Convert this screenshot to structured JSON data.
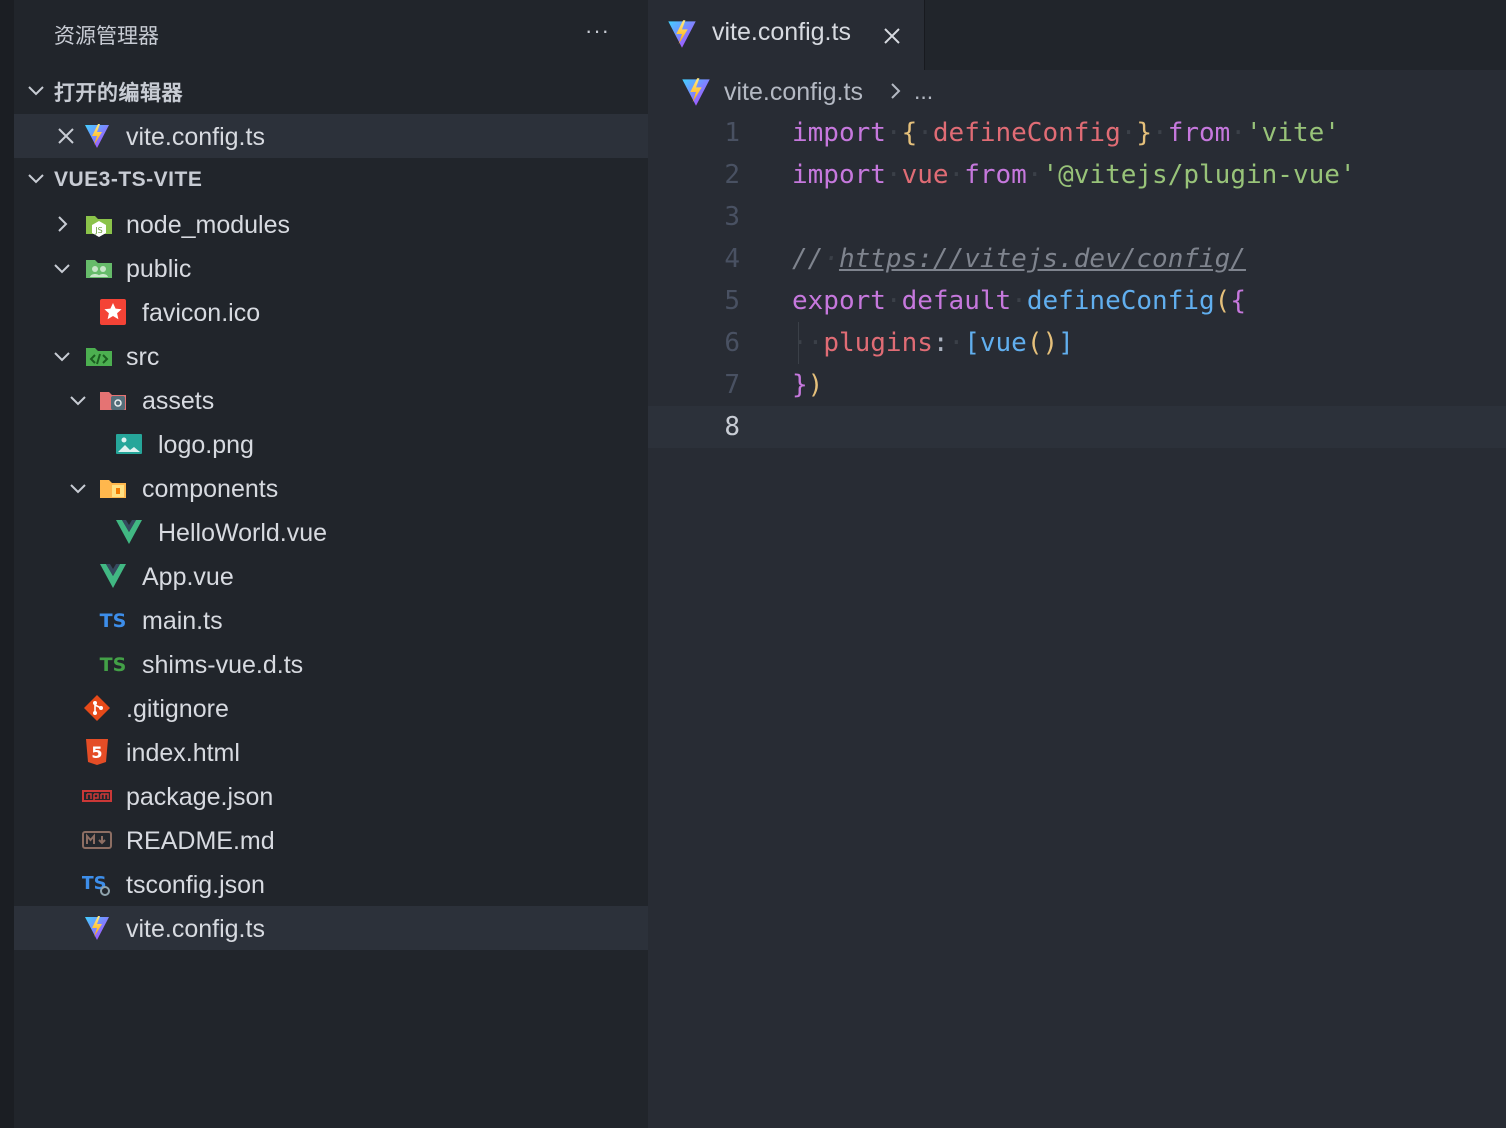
{
  "sidebar": {
    "title": "资源管理器",
    "more": "···",
    "open_editors": {
      "label": "打开的编辑器",
      "items": [
        {
          "name": "vite.config.ts"
        }
      ]
    },
    "project": {
      "label": "VUE3-TS-VITE",
      "tree": [
        {
          "name": "node_modules"
        },
        {
          "name": "public"
        },
        {
          "name": "favicon.ico"
        },
        {
          "name": "src"
        },
        {
          "name": "assets"
        },
        {
          "name": "logo.png"
        },
        {
          "name": "components"
        },
        {
          "name": "HelloWorld.vue"
        },
        {
          "name": "App.vue"
        },
        {
          "name": "main.ts"
        },
        {
          "name": "shims-vue.d.ts"
        },
        {
          "name": ".gitignore"
        },
        {
          "name": "index.html"
        },
        {
          "name": "package.json"
        },
        {
          "name": "README.md"
        },
        {
          "name": "tsconfig.json"
        },
        {
          "name": "vite.config.ts"
        }
      ]
    }
  },
  "editor": {
    "tab": {
      "label": "vite.config.ts"
    },
    "breadcrumb": {
      "file": "vite.config.ts",
      "more": "..."
    },
    "lines": {
      "l1": {
        "num": "1",
        "t1": "import",
        "t2": "{",
        "t3": "defineConfig",
        "t4": "}",
        "t5": "from",
        "t6": "'vite'"
      },
      "l2": {
        "num": "2",
        "t1": "import",
        "t2": "vue",
        "t3": "from",
        "t4": "'@vitejs/plugin-vue'"
      },
      "l3": {
        "num": "3"
      },
      "l4": {
        "num": "4",
        "t1": "//",
        "t2": "https://vitejs.dev/config/"
      },
      "l5": {
        "num": "5",
        "t1": "export",
        "t2": "default",
        "t3": "defineConfig",
        "t4": "(",
        "t5": "{"
      },
      "l6": {
        "num": "6",
        "t1": "plugins",
        "t2": ":",
        "t3": "[",
        "t4": "vue",
        "t5": "()",
        "t6": "]"
      },
      "l7": {
        "num": "7",
        "t1": "}",
        "t2": ")"
      },
      "l8": {
        "num": "8"
      }
    }
  },
  "colors": {
    "sidebar_bg": "#21252b",
    "editor_bg": "#282c34",
    "active_row": "#2c313a",
    "keyword": "#c678dd",
    "string": "#98c379",
    "function": "#61afef",
    "variable": "#e06c75",
    "bracket": "#e5c07b"
  }
}
